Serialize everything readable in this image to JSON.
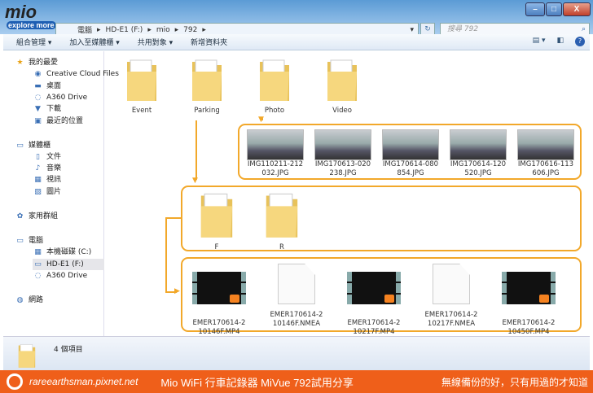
{
  "logo": {
    "text": "mio",
    "tagline": "explore more"
  },
  "window": {
    "minimize": "–",
    "maximize": "□",
    "close": "X"
  },
  "address": {
    "crumbs": [
      "電腦",
      "HD-E1 (F:)",
      "mio",
      "792"
    ],
    "search_placeholder": "搜尋 792"
  },
  "toolbar": {
    "organize": "組合管理 ▾",
    "add_library": "加入至媒體櫃 ▾",
    "share": "共用對象 ▾",
    "new_folder": "新增資料夾"
  },
  "sidebar": {
    "items": [
      {
        "label": "我的最愛",
        "icon": "star-icon"
      },
      {
        "label": "Creative Cloud Files",
        "icon": "cloud-icon"
      },
      {
        "label": "桌面",
        "icon": "desktop-icon"
      },
      {
        "label": "A360 Drive",
        "icon": "drive-icon"
      },
      {
        "label": "下載",
        "icon": "download-icon"
      },
      {
        "label": "最近的位置",
        "icon": "recent-icon"
      },
      {
        "label": "媒體櫃",
        "icon": "library-icon"
      },
      {
        "label": "文件",
        "icon": "document-icon"
      },
      {
        "label": "音樂",
        "icon": "music-icon"
      },
      {
        "label": "視訊",
        "icon": "video-icon"
      },
      {
        "label": "圖片",
        "icon": "picture-icon"
      },
      {
        "label": "家用群組",
        "icon": "homegroup-icon"
      },
      {
        "label": "電腦",
        "icon": "computer-icon"
      },
      {
        "label": "本機磁碟 (C:)",
        "icon": "disk-icon"
      },
      {
        "label": "HD-E1 (F:)",
        "icon": "usb-drive-icon"
      },
      {
        "label": "A360 Drive",
        "icon": "drive-icon"
      },
      {
        "label": "網路",
        "icon": "network-icon"
      }
    ]
  },
  "folders": [
    "Event",
    "Parking",
    "Photo",
    "Video"
  ],
  "photos": [
    {
      "l1": "IMG110211-212",
      "l2": "032.JPG"
    },
    {
      "l1": "IMG170613-020",
      "l2": "238.JPG"
    },
    {
      "l1": "IMG170614-080",
      "l2": "854.JPG"
    },
    {
      "l1": "IMG170614-120",
      "l2": "520.JPG"
    },
    {
      "l1": "IMG170616-113",
      "l2": "606.JPG"
    }
  ],
  "subfolders": [
    "F",
    "R"
  ],
  "videos": [
    {
      "l1": "EMER170614-2",
      "l2": "10146F.MP4",
      "type": "video"
    },
    {
      "l1": "EMER170614-2",
      "l2": "10146F.NMEA",
      "type": "doc"
    },
    {
      "l1": "EMER170614-2",
      "l2": "10217F.MP4",
      "type": "video"
    },
    {
      "l1": "EMER170614-2",
      "l2": "10217F.NMEA",
      "type": "doc"
    },
    {
      "l1": "EMER170614-2",
      "l2": "10450F.MP4",
      "type": "video"
    }
  ],
  "status": {
    "count": "4 個項目"
  },
  "footer": {
    "site": "rareearthsman.pixnet.net",
    "title": "Mio WiFi 行車記錄器 MiVue 792試用分享",
    "slogan": "無線備份的好，只有用過的才知道"
  },
  "colors": {
    "accent": "#f2a82a",
    "footer": "#ef5f1a"
  }
}
